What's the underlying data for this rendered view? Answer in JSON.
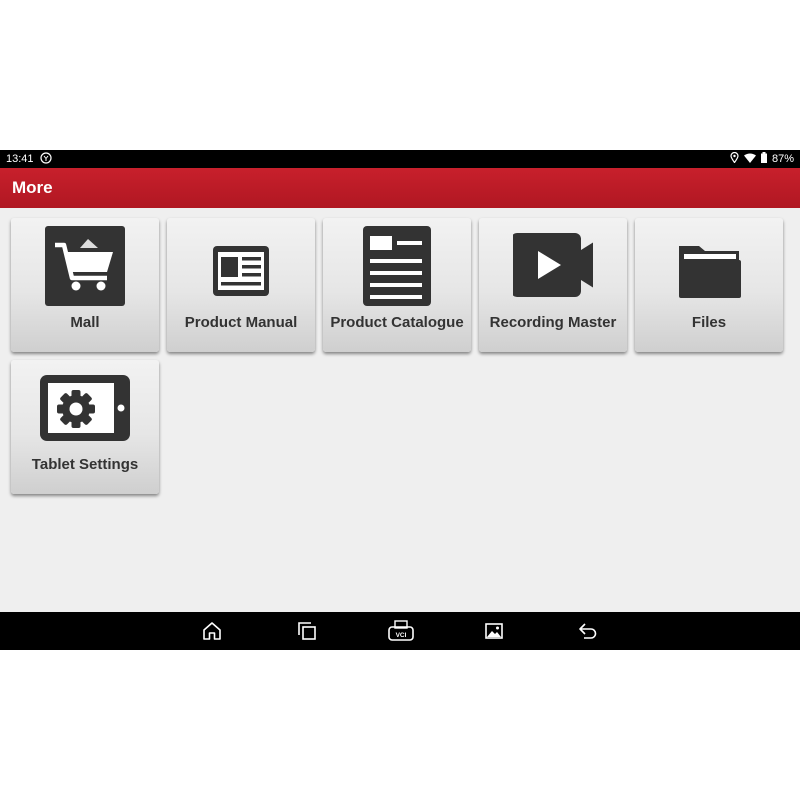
{
  "status_bar": {
    "time": "13:41",
    "battery_percent": "87%",
    "icons": [
      "notification-app-icon",
      "location-icon",
      "wifi-icon",
      "battery-icon"
    ]
  },
  "app_bar": {
    "title": "More",
    "color": "#b81c26"
  },
  "tiles": [
    {
      "label": "Mall",
      "icon": "shopping-cart-icon"
    },
    {
      "label": "Product Manual",
      "icon": "manual-icon"
    },
    {
      "label": "Product Catalogue",
      "icon": "catalogue-icon"
    },
    {
      "label": "Recording Master",
      "icon": "video-camera-icon"
    },
    {
      "label": "Files",
      "icon": "folder-icon"
    },
    {
      "label": "Tablet Settings",
      "icon": "tablet-settings-icon"
    }
  ],
  "nav_bar": {
    "buttons": [
      "home-icon",
      "recent-apps-icon",
      "vci-icon",
      "screenshot-icon",
      "back-icon"
    ],
    "vci_label": "VCI"
  },
  "colors": {
    "accent": "#b81c26",
    "icon_dark": "#333333",
    "background": "#efefef"
  }
}
